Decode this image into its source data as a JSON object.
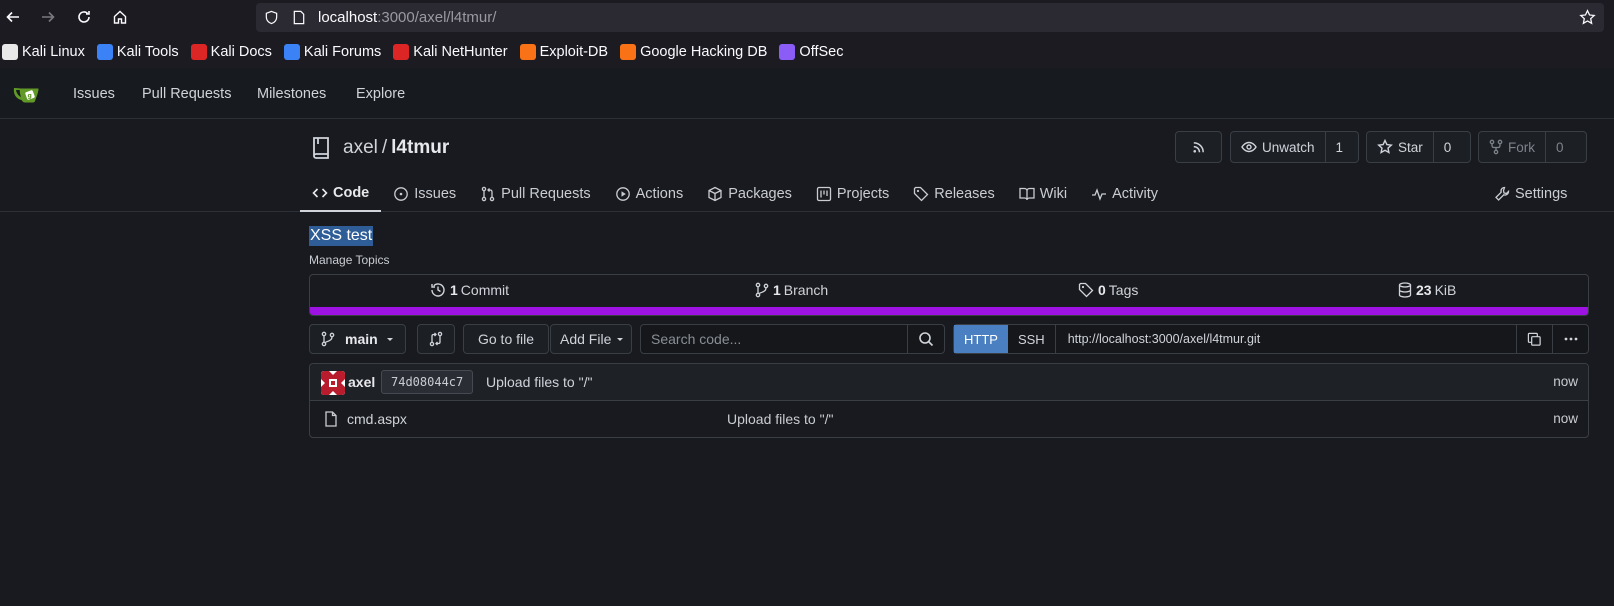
{
  "browser": {
    "url_host": "localhost",
    "url_rest": ":3000/axel/l4tmur/",
    "bookmarks": [
      {
        "label": "Kali Linux",
        "icon": "kali-dragon-icon",
        "color": "#e8e8e8"
      },
      {
        "label": "Kali Tools",
        "icon": "kali-tools-icon",
        "color": "#3b82f6"
      },
      {
        "label": "Kali Docs",
        "icon": "kali-docs-icon",
        "color": "#dc2626"
      },
      {
        "label": "Kali Forums",
        "icon": "kali-forums-icon",
        "color": "#3b82f6"
      },
      {
        "label": "Kali NetHunter",
        "icon": "nethunter-icon",
        "color": "#dc2626"
      },
      {
        "label": "Exploit-DB",
        "icon": "exploit-db-icon",
        "color": "#f97316"
      },
      {
        "label": "Google Hacking DB",
        "icon": "ghdb-icon",
        "color": "#f97316"
      },
      {
        "label": "OffSec",
        "icon": "offsec-icon",
        "color": "#8b5cf6"
      }
    ]
  },
  "gitea_nav": {
    "items": [
      "Issues",
      "Pull Requests",
      "Milestones",
      "Explore"
    ]
  },
  "repo": {
    "owner": "axel",
    "separator": "/",
    "name": "l4tmur",
    "unwatch_label": "Unwatch",
    "watch_count": "1",
    "star_label": "Star",
    "star_count": "0",
    "fork_label": "Fork",
    "fork_count": "0",
    "tabs": [
      "Code",
      "Issues",
      "Pull Requests",
      "Actions",
      "Packages",
      "Projects",
      "Releases",
      "Wiki",
      "Activity"
    ],
    "settings_label": "Settings",
    "description": "XSS test",
    "manage_topics": "Manage Topics"
  },
  "stats": {
    "commits_count": "1",
    "commits_label": "Commit",
    "branches_count": "1",
    "branches_label": "Branch",
    "tags_count": "0",
    "tags_label": "Tags",
    "size_count": "23",
    "size_label": "KiB",
    "language_color": "#9e12e3"
  },
  "toolbar": {
    "branch": "main",
    "go_to_file": "Go to file",
    "add_file": "Add File",
    "search_placeholder": "Search code...",
    "http_label": "HTTP",
    "ssh_label": "SSH",
    "clone_url": "http://localhost:3000/axel/l4tmur.git"
  },
  "latest_commit": {
    "author": "axel",
    "sha": "74d08044c7",
    "message": "Upload files to \"/\"",
    "time": "now"
  },
  "files": [
    {
      "name": "cmd.aspx",
      "message": "Upload files to \"/\"",
      "time": "now"
    }
  ]
}
